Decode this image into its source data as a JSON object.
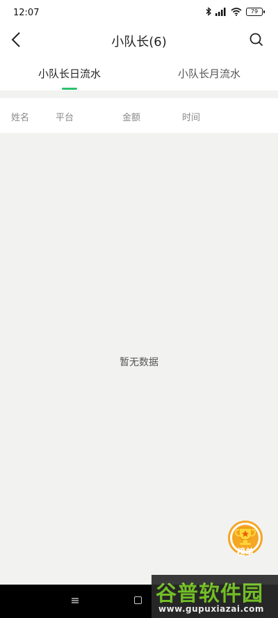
{
  "status_bar": {
    "time": "12:07",
    "battery": "79",
    "icons": [
      "bluetooth-icon",
      "signal-icon",
      "wifi-icon",
      "battery-icon"
    ]
  },
  "header": {
    "title": "小队长(6)",
    "back_icon": "chevron-left-icon",
    "search_icon": "search-icon"
  },
  "tabs": [
    {
      "label": "小队长日流水",
      "active": true
    },
    {
      "label": "小队长月流水",
      "active": false
    }
  ],
  "table": {
    "columns": [
      "姓名",
      "平台",
      "金额",
      "时间"
    ],
    "rows": []
  },
  "empty_state": {
    "text": "暂无数据"
  },
  "rank_button": {
    "label": "榜单",
    "icon": "trophy-icon"
  },
  "nav_bar": {
    "icons": [
      "menu-icon",
      "home-icon"
    ]
  },
  "watermark": {
    "main": "谷普软件园",
    "url": "www.gupuxiazai.com"
  },
  "colors": {
    "accent": "#2ec16b",
    "background": "#f2f2f0",
    "badge": "#f5a623"
  }
}
